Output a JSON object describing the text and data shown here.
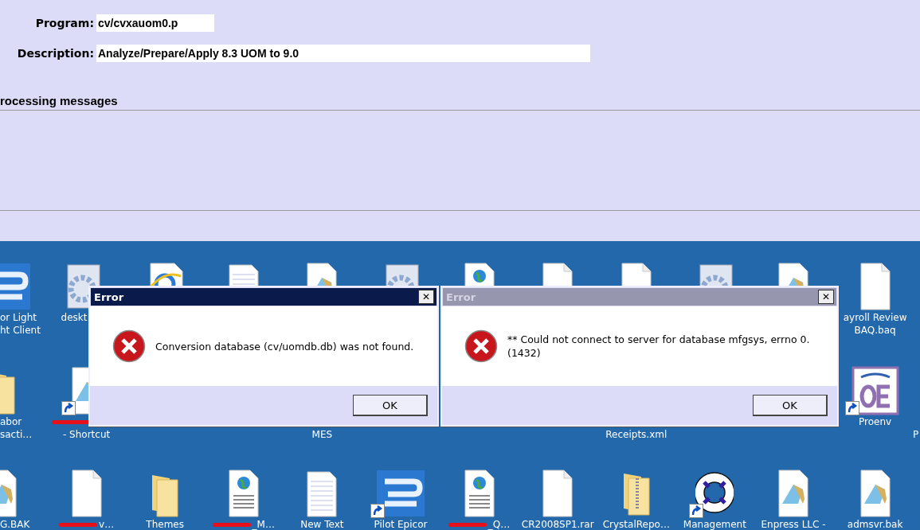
{
  "form": {
    "program_label": "Program:",
    "program_value": "cv/cvxauom0.p",
    "description_label": "Description:",
    "description_value": "Analyze/Prepare/Apply 8.3 UOM to 9.0",
    "messages_label": "rocessing messages"
  },
  "desktop": {
    "rows": [
      {
        "icons": [
          {
            "kind": "epicor",
            "shortcut": false,
            "lines": [
              "or Light",
              "ht Client"
            ]
          },
          {
            "kind": "gear-doc",
            "shortcut": false,
            "lines": [
              "deskt"
            ]
          },
          {
            "kind": "ie",
            "shortcut": false
          },
          {
            "kind": "notepad",
            "shortcut": false
          },
          {
            "kind": "wordpad",
            "shortcut": false
          },
          {
            "kind": "gear-doc",
            "shortcut": false
          },
          {
            "kind": "web",
            "shortcut": false
          },
          {
            "kind": "doc",
            "shortcut": false
          },
          {
            "kind": "doc",
            "shortcut": false
          },
          {
            "kind": "gear-doc",
            "shortcut": false
          },
          {
            "kind": "wordpad",
            "shortcut": false
          },
          {
            "kind": "doc",
            "shortcut": false,
            "lines": [
              "ayroll Review",
              "BAQ.baq"
            ]
          }
        ]
      },
      {
        "icons": [
          {
            "kind": "folder",
            "shortcut": false,
            "lines": [
              "abor",
              "sacti…"
            ]
          },
          {
            "kind": "wordpad",
            "shortcut": true,
            "redacted": true,
            "lines": [
              "- Shortcut"
            ]
          },
          {
            "kind": "none",
            "lines": [
              "MES"
            ]
          },
          {
            "kind": "none",
            "lines": [
              "Receipts.xml"
            ]
          },
          {
            "kind": "oe",
            "shortcut": true,
            "lines": [
              "Proenv"
            ]
          },
          {
            "kind": "none",
            "lines": [
              "P"
            ]
          }
        ]
      },
      {
        "icons": [
          {
            "kind": "wordpad",
            "shortcut": false,
            "lines": [
              "G.BAK"
            ]
          },
          {
            "kind": "doc",
            "shortcut": false,
            "redacted": true,
            "lines": [
              "v…"
            ]
          },
          {
            "kind": "folder",
            "shortcut": false,
            "lines": [
              "Themes"
            ]
          },
          {
            "kind": "web",
            "shortcut": false,
            "redacted": true,
            "lines": [
              "_M…"
            ]
          },
          {
            "kind": "notepad",
            "shortcut": false,
            "lines": [
              "New Text"
            ]
          },
          {
            "kind": "epicor",
            "shortcut": true,
            "lines": [
              "Pilot Epicor"
            ]
          },
          {
            "kind": "web",
            "shortcut": false,
            "redacted": true,
            "lines": [
              "_Q…"
            ]
          },
          {
            "kind": "doc",
            "shortcut": false,
            "lines": [
              "CR2008SP1.rar"
            ]
          },
          {
            "kind": "zip",
            "shortcut": false,
            "lines": [
              "CrystalRepo…"
            ]
          },
          {
            "kind": "lifebuoy",
            "shortcut": true,
            "lines": [
              "Management"
            ]
          },
          {
            "kind": "wordpad",
            "shortcut": false,
            "lines": [
              "Enpress LLC -"
            ]
          },
          {
            "kind": "wordpad",
            "shortcut": false,
            "lines": [
              "admsvr.bak"
            ]
          }
        ]
      }
    ]
  },
  "dialogs": [
    {
      "title": "Error",
      "active": true,
      "message_lines": [
        "Conversion database (cv/uomdb.db) was not found."
      ],
      "close": "✕",
      "button": "OK"
    },
    {
      "title": "Error",
      "active": false,
      "message_lines": [
        "** Could not connect to server for database mfgsys, errno 0.",
        "(1432)"
      ],
      "close": "✕",
      "button": "OK"
    }
  ]
}
